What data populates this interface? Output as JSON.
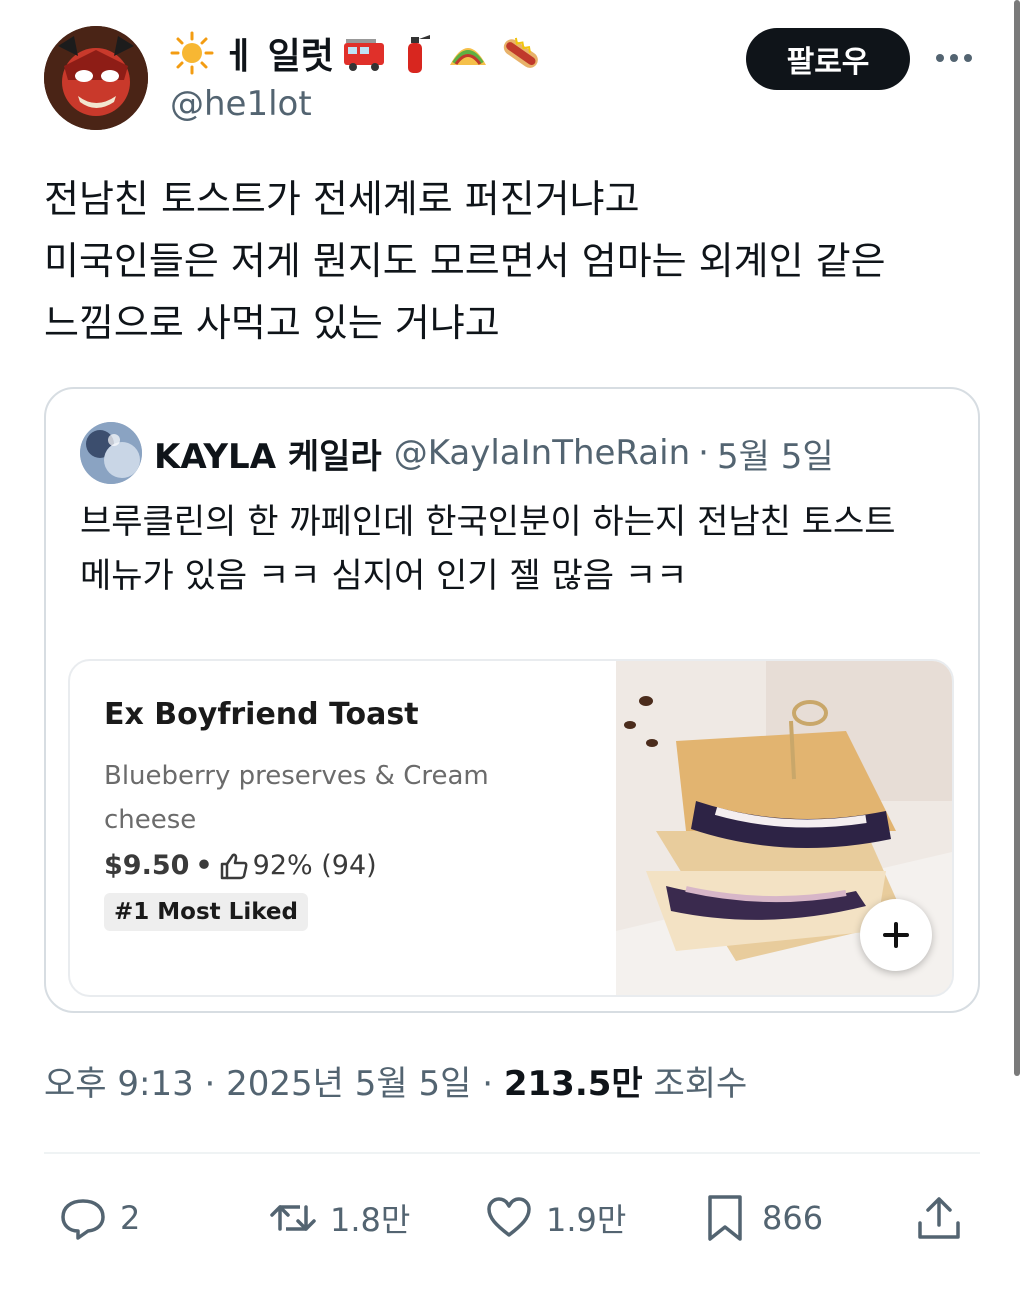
{
  "author": {
    "display_name": "ㅔ 일럿",
    "name_emoji_prefix": "sun-icon",
    "name_emoji_suffix": [
      "fire-engine-icon",
      "fire-extinguisher-icon",
      "taco-icon",
      "hotdog-icon"
    ],
    "handle": "@he1lot"
  },
  "header": {
    "follow_label": "팔로우",
    "more_icon": "more-icon"
  },
  "tweet": {
    "lines": [
      "전남친 토스트가 전세계로 퍼진거냐고",
      "미국인들은 저게 뭔지도 모르면서 엄마는 외계인 같은",
      "느낌으로 사먹고 있는 거냐고"
    ]
  },
  "quote": {
    "name": "KAYLA 케일라",
    "handle": "@KaylaInTheRain",
    "dot": "·",
    "date": "5월 5일",
    "lines": [
      "브루클린의 한 까페인데 한국인분이 하는지 전남친 토스트",
      "메뉴가 있음 ㅋㅋ 심지어 인기 젤 많음 ㅋㅋ"
    ],
    "card": {
      "title": "Ex Boyfriend Toast",
      "description": "Blueberry preserves & Cream cheese",
      "price": "$9.50",
      "separator": "•",
      "rating": "92% (94)",
      "badge": "#1 Most Liked",
      "add_icon": "plus-icon"
    }
  },
  "meta": {
    "time": "오후 9:13",
    "dot1": "·",
    "date": "2025년 5월 5일",
    "dot2": "·",
    "views": "213.5만",
    "views_label": "조회수"
  },
  "actions": {
    "reply_count": "2",
    "retweet_count": "1.8만",
    "like_count": "1.9만",
    "bookmark_count": "866"
  },
  "colors": {
    "text": "#0f1419",
    "secondary": "#536471",
    "border": "#d7dde2",
    "button": "#0f1419"
  }
}
